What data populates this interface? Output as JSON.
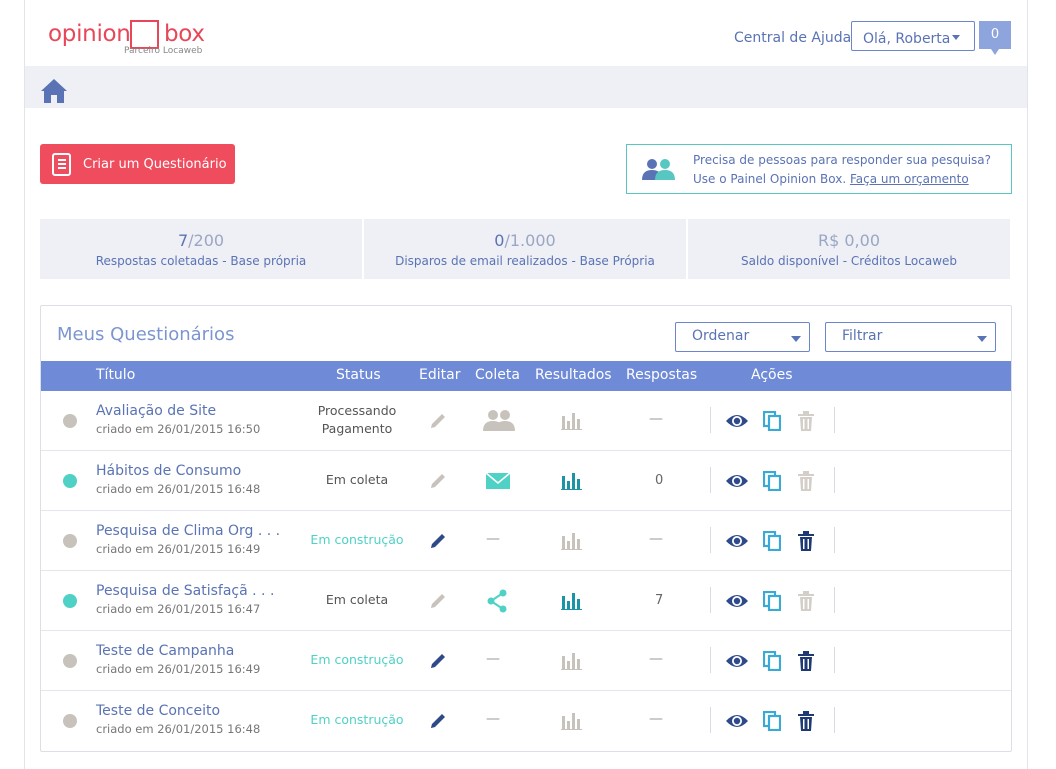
{
  "header": {
    "logo_word1": "opinion",
    "logo_word2": "box",
    "logo_sub": "Parceiro Locaweb",
    "help_link": "Central de Ajuda",
    "user_menu": "Olá, Roberta",
    "notifications": "0"
  },
  "actions": {
    "create_button": "Criar um Questionário",
    "promo_line1": "Precisa de pessoas para responder sua pesquisa?",
    "promo_line2": "Use o Painel Opinion Box. ",
    "promo_link": "Faça  um  orçamento"
  },
  "stats": [
    {
      "value": "7",
      "total": "/200",
      "label": "Respostas coletadas - Base própria"
    },
    {
      "value": "0",
      "total": "/1.000",
      "label": "Disparos de email realizados - Base Própria"
    },
    {
      "value": "R$ 0,00",
      "total": "",
      "label": "Saldo disponível - Créditos Locaweb"
    }
  ],
  "panel": {
    "title": "Meus Questionários",
    "sort_label": "Ordenar",
    "filter_label": "Filtrar"
  },
  "table": {
    "headers": {
      "title": "Título",
      "status": "Status",
      "edit": "Editar",
      "collect": "Coleta",
      "results": "Resultados",
      "responses": "Respostas",
      "actions": "Ações"
    },
    "rows": [
      {
        "title": "Avaliação de Site",
        "created": "criado em 26/01/2015 16:50",
        "status_line1": "Processando",
        "status_line2": "Pagamento",
        "responses": "—"
      },
      {
        "title": "Hábitos de Consumo",
        "created": "criado em 26/01/2015 16:48",
        "status_line1": "Em coleta",
        "status_line2": "",
        "responses": "0"
      },
      {
        "title": "Pesquisa de Clima Org . . .",
        "created": "criado em 26/01/2015 16:49",
        "status_line1": "Em construção",
        "status_line2": "",
        "collect_dash": "—",
        "responses": "—"
      },
      {
        "title": "Pesquisa de Satisfaçã . . .",
        "created": "criado em 26/01/2015 16:47",
        "status_line1": "Em coleta",
        "status_line2": "",
        "responses": "7"
      },
      {
        "title": "Teste de Campanha",
        "created": "criado em 26/01/2015 16:49",
        "status_line1": "Em construção",
        "status_line2": "",
        "collect_dash": "—",
        "responses": "—"
      },
      {
        "title": "Teste de Conceito",
        "created": "criado em 26/01/2015 16:48",
        "status_line1": "Em construção",
        "status_line2": "",
        "collect_dash": "—",
        "responses": "—"
      }
    ]
  },
  "colors": {
    "brand": "#e8475a",
    "primary": "#5a73b4",
    "teal": "#4fd1c5",
    "muted": "#c8c2bc",
    "header_bar": "#6f8ad6"
  }
}
